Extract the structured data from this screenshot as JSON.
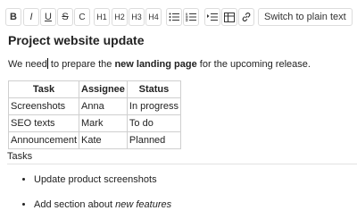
{
  "toolbar": {
    "buttons": [
      {
        "label": "B",
        "name": "bold-button"
      },
      {
        "label": "I",
        "name": "italic-button"
      },
      {
        "label": "U",
        "name": "underline-button"
      },
      {
        "label": "S",
        "name": "strikethrough-button"
      },
      {
        "label": "C",
        "name": "code-button"
      },
      {
        "label": "H1",
        "name": "heading-1-button"
      },
      {
        "label": "H2",
        "name": "heading-2-button"
      },
      {
        "label": "H3",
        "name": "heading-3-button"
      },
      {
        "label": "H4",
        "name": "heading-4-button"
      }
    ],
    "icons": [
      "bullet-list-icon",
      "numbered-list-icon",
      "indent-icon",
      "table-icon",
      "link-icon"
    ],
    "plain_text_label": "Switch to plain text"
  },
  "document": {
    "title": "Project website update",
    "paragraph": {
      "before_caret": "We need",
      "after_caret": " to prepare the ",
      "bold": "new landing page",
      "after_bold": " for the upcoming release."
    },
    "table": {
      "headers": [
        "Task",
        "Assignee",
        "Status"
      ],
      "rows": [
        [
          "Screenshots",
          "Anna",
          "In progress"
        ],
        [
          "SEO texts",
          "Mark",
          "To do"
        ],
        [
          "Announcement",
          "Kate",
          "Planned"
        ]
      ]
    },
    "section_label": "Tasks",
    "list": [
      {
        "text": "Update product screenshots",
        "italic": ""
      },
      {
        "text": "Add section about ",
        "italic": "new features"
      }
    ]
  }
}
